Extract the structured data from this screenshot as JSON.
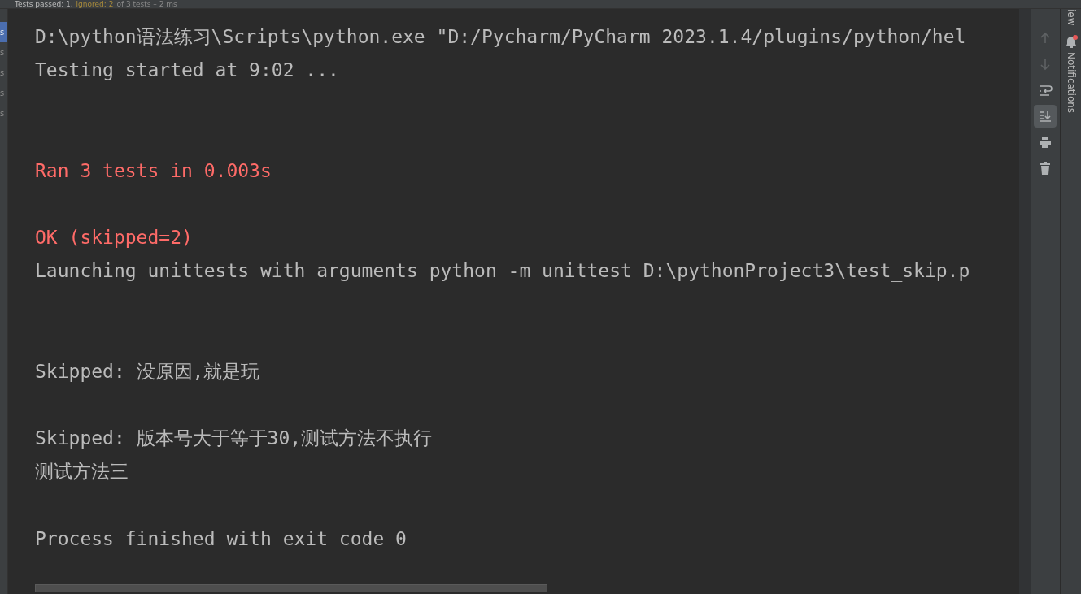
{
  "status_bar": {
    "passed": "Tests passed: 1,",
    "ignored": "ignored: 2",
    "rest": "of 3 tests – 2 ms"
  },
  "test_tree": {
    "items": [
      {
        "label": "s",
        "selected": true
      },
      {
        "label": "s",
        "selected": false
      },
      {
        "label": "s",
        "selected": false
      },
      {
        "label": "s",
        "selected": false
      },
      {
        "label": "s",
        "selected": false
      }
    ]
  },
  "console": {
    "lines": [
      {
        "text": "D:\\python语法练习\\Scripts\\python.exe \"D:/Pycharm/PyCharm 2023.1.4/plugins/python/hel",
        "kind": "normal"
      },
      {
        "text": "Testing started at 9:02 ...",
        "kind": "normal"
      },
      {
        "kind": "blank"
      },
      {
        "kind": "blank"
      },
      {
        "text": "Ran 3 tests in 0.003s",
        "kind": "error"
      },
      {
        "kind": "blank"
      },
      {
        "text": "OK (skipped=2)",
        "kind": "error"
      },
      {
        "text": "Launching unittests with arguments python -m unittest D:\\pythonProject3\\test_skip.p",
        "kind": "normal"
      },
      {
        "kind": "blank"
      },
      {
        "kind": "blank"
      },
      {
        "text": "Skipped: 没原因,就是玩",
        "kind": "normal"
      },
      {
        "kind": "blank"
      },
      {
        "text": "Skipped: 版本号大于等于30,测试方法不执行",
        "kind": "normal"
      },
      {
        "text": "测试方法三",
        "kind": "normal"
      },
      {
        "kind": "blank"
      },
      {
        "text": "Process finished with exit code 0",
        "kind": "normal"
      }
    ]
  },
  "toolbar": [
    {
      "kind": "up",
      "disabled": true,
      "selected": false
    },
    {
      "kind": "down",
      "disabled": true,
      "selected": false
    },
    {
      "kind": "wrap",
      "disabled": false,
      "selected": false
    },
    {
      "kind": "scroll-end",
      "disabled": false,
      "selected": true
    },
    {
      "kind": "print",
      "disabled": false,
      "selected": false
    },
    {
      "kind": "trash",
      "disabled": false,
      "selected": false
    }
  ],
  "side_panel": {
    "labels": [
      "iew",
      "Notifications"
    ]
  }
}
